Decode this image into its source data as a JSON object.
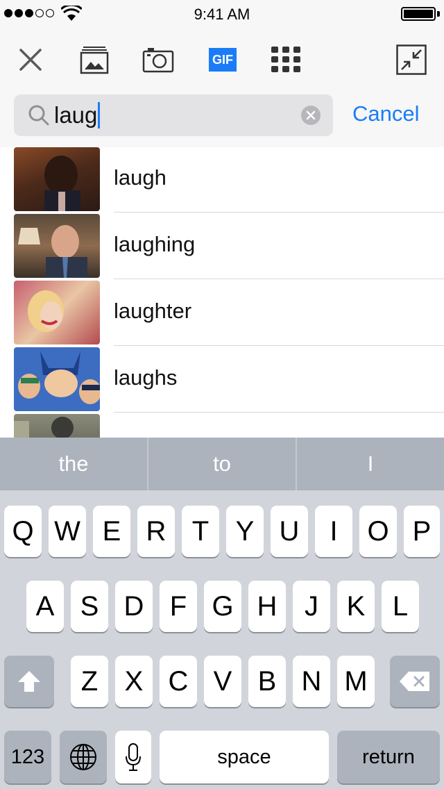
{
  "status_bar": {
    "time": "9:41 AM"
  },
  "toolbar": {
    "icons": [
      "close-icon",
      "image-icon",
      "camera-icon",
      "gif-icon",
      "grid-icon",
      "collapse-icon"
    ],
    "gif_label": "GIF",
    "accent": "#1a7cf8"
  },
  "search": {
    "query": "laug",
    "cancel_label": "Cancel"
  },
  "results": [
    {
      "label": "laugh",
      "thumb_colors": [
        "#6b3a22",
        "#3a1f14"
      ]
    },
    {
      "label": "laughing",
      "thumb_colors": [
        "#8a6a50",
        "#2f3b52"
      ]
    },
    {
      "label": "laughter",
      "thumb_colors": [
        "#e8c9a8",
        "#b04b55"
      ]
    },
    {
      "label": "laughs",
      "thumb_colors": [
        "#2f5fb0",
        "#e8a06a"
      ]
    },
    {
      "label": "",
      "thumb_colors": [
        "#7a7a70",
        "#3d4030"
      ]
    }
  ],
  "keyboard": {
    "suggestions": [
      "the",
      "to",
      "I"
    ],
    "row1": [
      "Q",
      "W",
      "E",
      "R",
      "T",
      "Y",
      "U",
      "I",
      "O",
      "P"
    ],
    "row2": [
      "A",
      "S",
      "D",
      "F",
      "G",
      "H",
      "J",
      "K",
      "L"
    ],
    "row3": [
      "Z",
      "X",
      "C",
      "V",
      "B",
      "N",
      "M"
    ],
    "numbers_label": "123",
    "space_label": "space",
    "return_label": "return"
  }
}
